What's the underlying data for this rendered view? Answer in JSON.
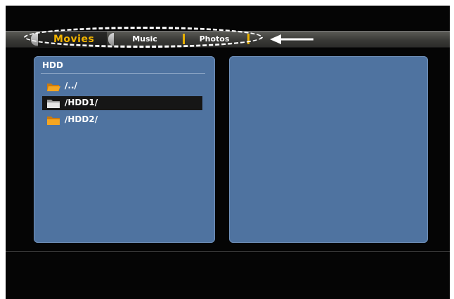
{
  "tabs": [
    {
      "label": "Movies",
      "active": true
    },
    {
      "label": "Music",
      "active": false
    },
    {
      "label": "Photos",
      "active": false
    }
  ],
  "left_panel": {
    "title": "HDD",
    "items": [
      {
        "name": "/../",
        "icon": "folder-open-icon",
        "selected": false
      },
      {
        "name": "/HDD1/",
        "icon": "folder-icon",
        "selected": true
      },
      {
        "name": "/HDD2/",
        "icon": "folder-icon",
        "selected": false
      }
    ]
  },
  "colors": {
    "active_tab_text": "#f2b400",
    "separator": "#e8b000",
    "panel_bg": "#4f73a0",
    "selection_bg": "#161616",
    "annotation": "#ffffff"
  }
}
